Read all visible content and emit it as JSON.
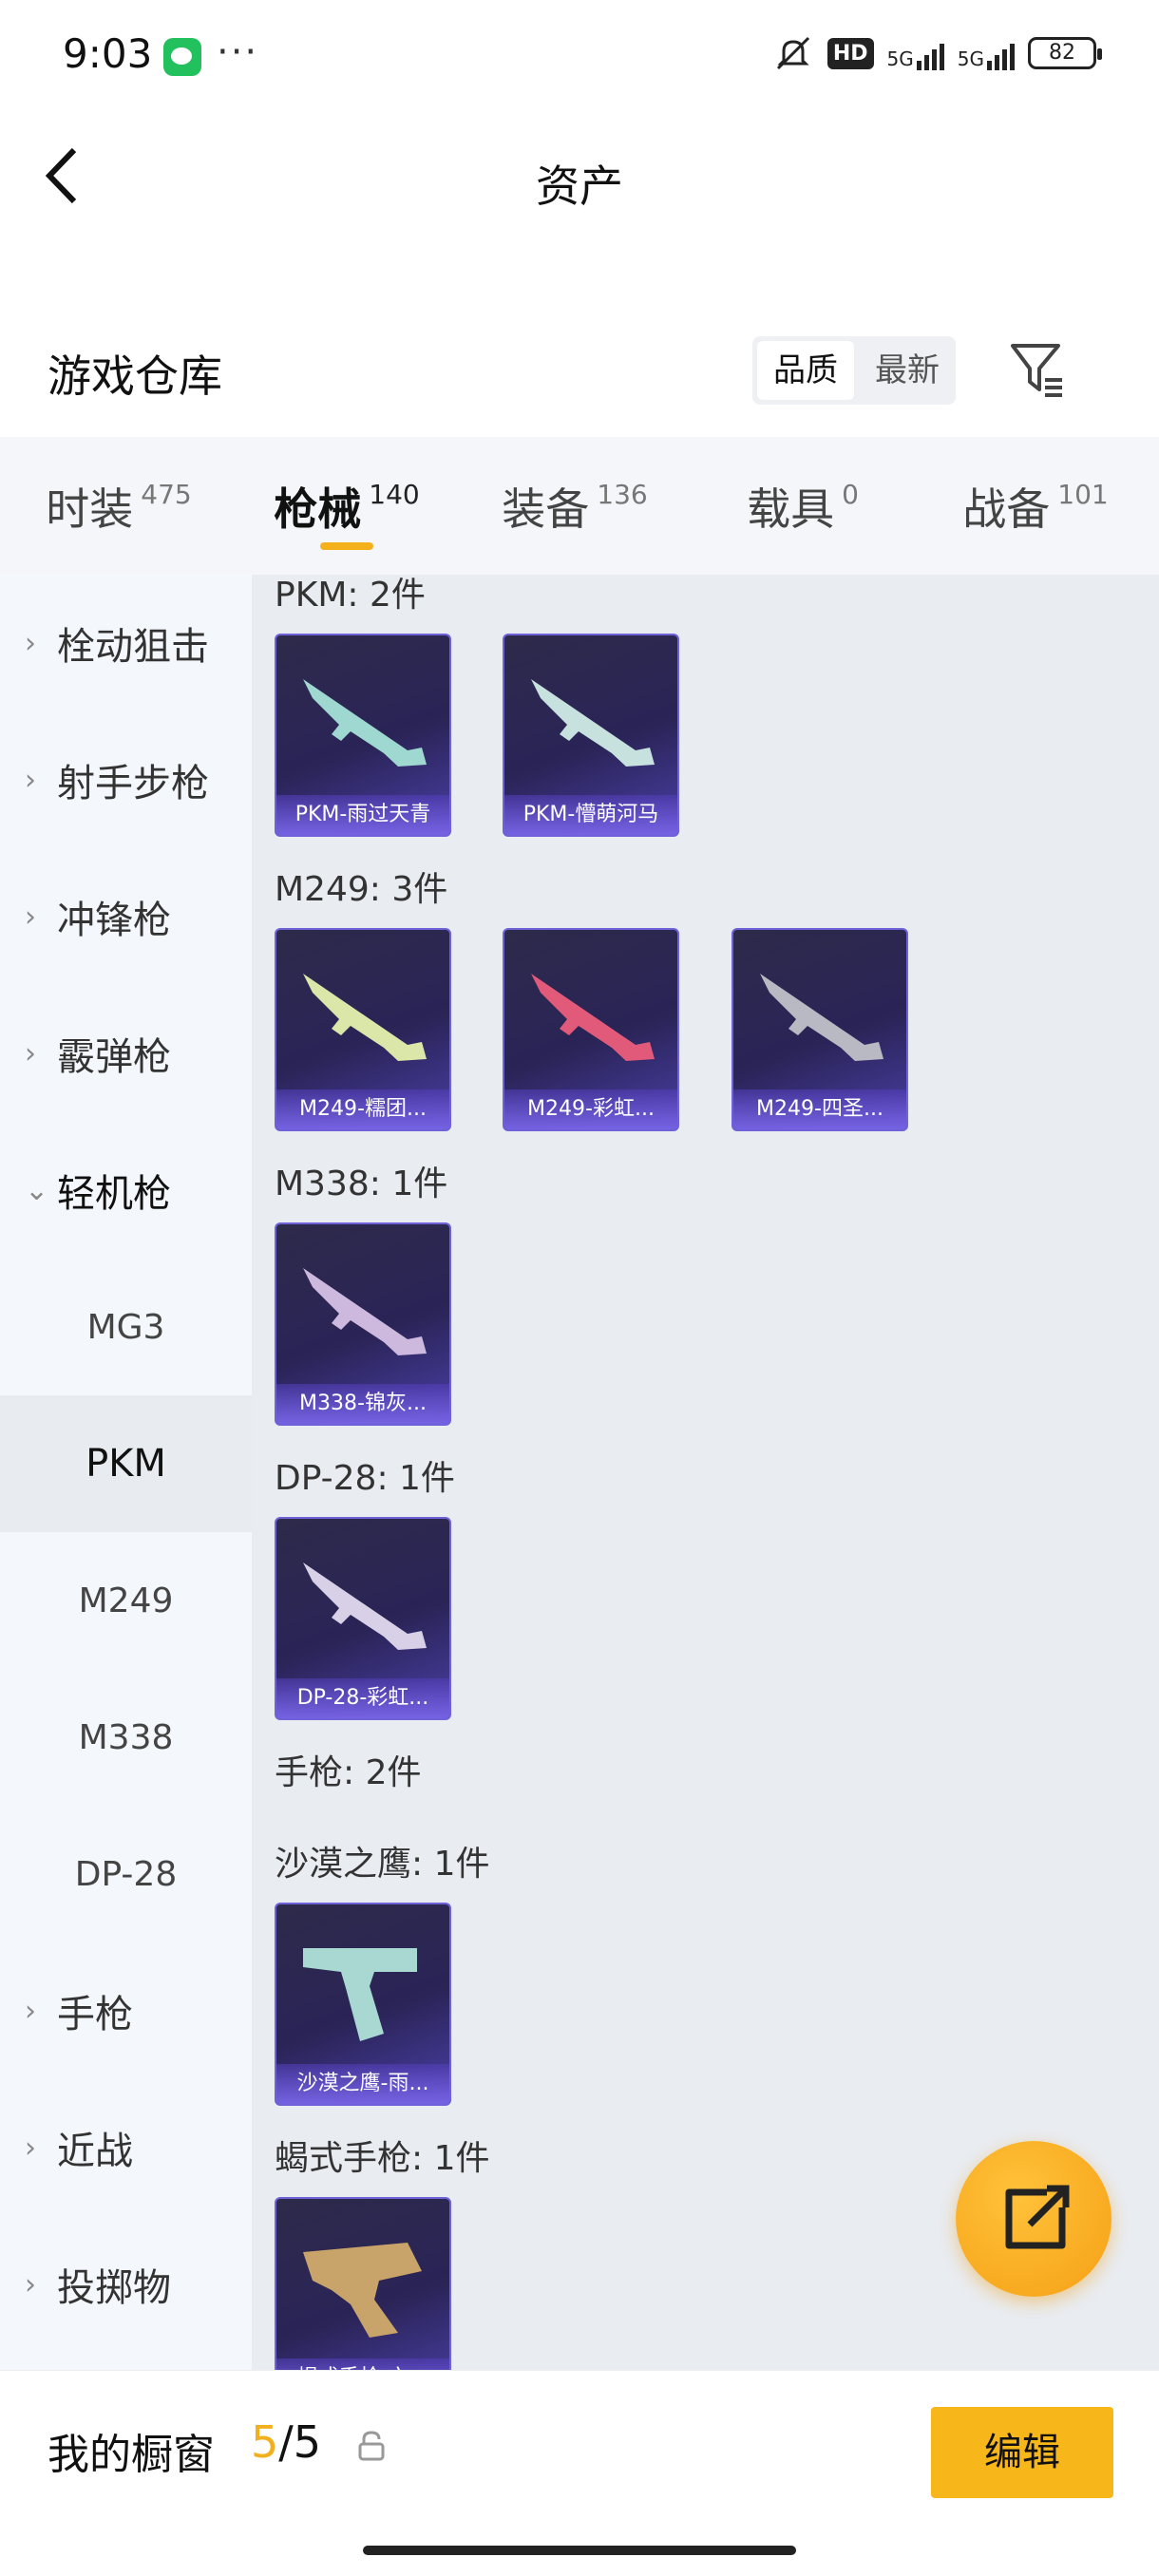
{
  "status_bar": {
    "time": "9:03",
    "more": "···",
    "hd": "HD",
    "net1": "5G",
    "net2": "5G",
    "battery": "82"
  },
  "header": {
    "title": "资产"
  },
  "warehouse": {
    "title": "游戏仓库",
    "sort_quality": "品质",
    "sort_newest": "最新"
  },
  "tabs": [
    {
      "label": "时装",
      "count": "475"
    },
    {
      "label": "枪械",
      "count": "140"
    },
    {
      "label": "装备",
      "count": "136"
    },
    {
      "label": "载具",
      "count": "0"
    },
    {
      "label": "战备",
      "count": "101"
    }
  ],
  "sidebar": {
    "items": [
      {
        "label": "栓动狙击"
      },
      {
        "label": "射手步枪"
      },
      {
        "label": "冲锋枪"
      },
      {
        "label": "霰弹枪"
      },
      {
        "label": "轻机枪"
      }
    ],
    "sub_items": [
      {
        "label": "MG3"
      },
      {
        "label": "PKM"
      },
      {
        "label": "M249"
      },
      {
        "label": "M338"
      },
      {
        "label": "DP-28"
      }
    ],
    "bottom_items": [
      {
        "label": "手枪"
      },
      {
        "label": "近战"
      },
      {
        "label": "投掷物"
      }
    ]
  },
  "content": {
    "sections": [
      {
        "label": "PKM: 2件",
        "items": [
          "PKM-雨过天青",
          "PKM-懵萌河马"
        ]
      },
      {
        "label": "M249: 3件",
        "items": [
          "M249-糯团...",
          "M249-彩虹...",
          "M249-四圣..."
        ]
      },
      {
        "label": "M338: 1件",
        "items": [
          "M338-锦灰..."
        ]
      },
      {
        "label": "DP-28: 1件",
        "items": [
          "DP-28-彩虹..."
        ]
      },
      {
        "label": "手枪: 2件",
        "items": []
      },
      {
        "label": "沙漠之鹰: 1件",
        "items": [
          "沙漠之鹰-雨..."
        ]
      },
      {
        "label": "蝎式手枪: 1件",
        "items": [
          "蝎式手枪-六..."
        ]
      }
    ]
  },
  "bottom_bar": {
    "label": "我的橱窗",
    "current": "5",
    "separator": "/",
    "total": "5",
    "edit": "编辑"
  },
  "colors": {
    "accent": "#f7b71b",
    "card_border": "#6f62d8",
    "content_bg": "#e9ecf1"
  }
}
